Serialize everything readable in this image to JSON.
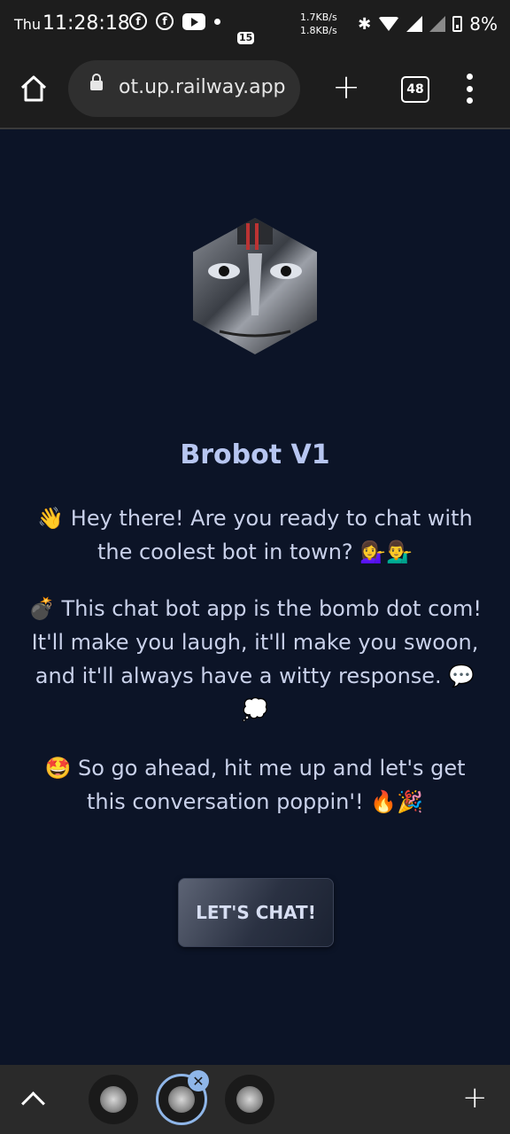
{
  "status_bar": {
    "day": "Thu",
    "time": "11:28:18",
    "notification_badge": "15",
    "net_up": "1.7KB/s",
    "net_down": "1.8KB/s",
    "battery": "8%"
  },
  "browser": {
    "url": "ot.up.railway.app",
    "tabs_count": "48",
    "icons": [
      "home-icon",
      "lock-icon",
      "plus-icon",
      "tabs-icon",
      "menu-icon"
    ]
  },
  "page": {
    "title": "Brobot V1",
    "paragraph1": "👋 Hey there! Are you ready to chat with the coolest bot in town? 💁‍♀️💁‍♂️",
    "paragraph2": "💣 This chat bot app is the bomb dot com! It'll make you laugh, it'll make you swoon, and it'll always have a witty response. 💬 💭",
    "paragraph3": "🤩 So go ahead, hit me up and let's get this conversation poppin'! 🔥🎉",
    "cta_label": "LET'S CHAT!",
    "colors": {
      "background": "#0c1427",
      "title": "#b7c6f1",
      "text": "#c9d1ea"
    }
  },
  "tab_strip": {
    "close_label": "✕",
    "add_label": "+"
  }
}
